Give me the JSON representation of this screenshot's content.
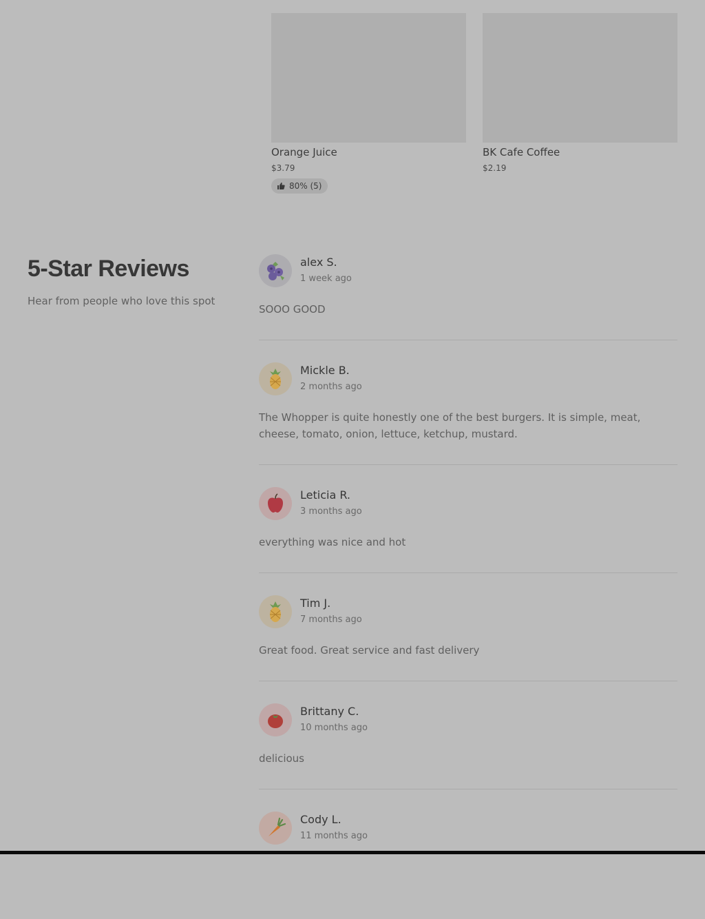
{
  "products": [
    {
      "name": "Orange Juice",
      "price": "$3.79",
      "rating": "80% (5)"
    },
    {
      "name": "BK Cafe Coffee",
      "price": "$2.19"
    }
  ],
  "reviews_section": {
    "title": "5-Star Reviews",
    "subtitle": "Hear from people who love this spot",
    "reviews": [
      {
        "name": "alex S.",
        "date": "1 week ago",
        "text": "SOOO GOOD",
        "avatar_icon": "blueberry-icon"
      },
      {
        "name": "Mickle B.",
        "date": "2 months ago",
        "text": "The Whopper is quite honestly one of the best burgers. It is simple, meat, cheese, tomato, onion, lettuce, ketchup, mustard.",
        "avatar_icon": "pineapple-icon"
      },
      {
        "name": "Leticia R.",
        "date": "3 months ago",
        "text": "everything was nice and hot",
        "avatar_icon": "apple-icon"
      },
      {
        "name": "Tim J.",
        "date": "7 months ago",
        "text": "Great food. Great service and fast delivery",
        "avatar_icon": "pineapple-icon"
      },
      {
        "name": "Brittany C.",
        "date": "10 months ago",
        "text": "delicious",
        "avatar_icon": "tomato-icon"
      },
      {
        "name": "Cody L.",
        "date": "11 months ago",
        "avatar_icon": "carrot-icon"
      }
    ]
  }
}
